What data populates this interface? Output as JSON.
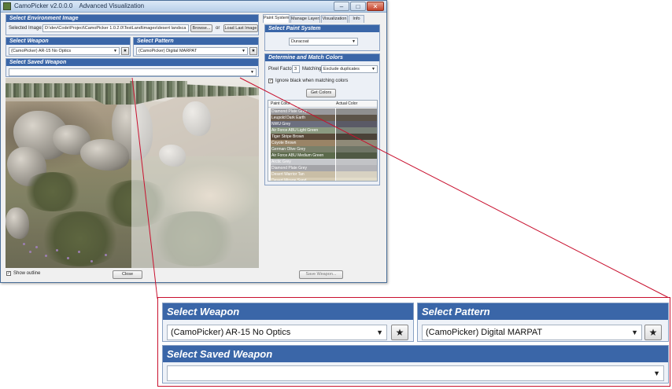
{
  "window": {
    "app_title": "CamoPicker",
    "version": "v2.0.0.0",
    "mode": "Advanced Visualization"
  },
  "environment": {
    "header": "Select Environment Image",
    "selected_label": "Selected Image:",
    "path_value": "D:\\dev\\Code\\Project\\CamoPicker 1.0.2.0\\TestLand\\images\\desert landsca",
    "browse_label": "Browse...",
    "or_label": "or",
    "load_last_label": "Load Last Image"
  },
  "weapon": {
    "header": "Select Weapon",
    "selected": "(CamoPicker) AR-15 No Optics",
    "star_label": "★"
  },
  "pattern": {
    "header": "Select Pattern",
    "selected": "(CamoPicker) Digital MARPAT",
    "star_label": "★"
  },
  "saved_weapon": {
    "header": "Select Saved Weapon",
    "selected": ""
  },
  "bottom": {
    "show_outline_label": "Show outline",
    "show_outline_checked": "✓",
    "close_label": "Close",
    "save_label": "Save Weapon..."
  },
  "tabs": [
    {
      "label": "Paint System"
    },
    {
      "label": "Manage Layers"
    },
    {
      "label": "Visualization"
    },
    {
      "label": "Info"
    }
  ],
  "paint_system": {
    "header": "Select Paint System",
    "selected": "Duracoat"
  },
  "colors": {
    "header": "Determine and Match Colors",
    "pixel_factor_label": "Pixel Factor",
    "pixel_factor_value": "3",
    "matching_label": "Matching",
    "matching_value": "Exclude duplicates",
    "ignore_label": "Ignore black when matching colors",
    "ignore_checked": "✓",
    "get_colors_label": "Get Colors",
    "col_paint": "Paint Color",
    "col_actual": "Actual Color",
    "rows": [
      {
        "name": "Diamond Plate Grey",
        "paint": "#9a9a9e",
        "actual": "#8f8f8f"
      },
      {
        "name": "Leupold Dark Earth",
        "paint": "#6e5f50",
        "actual": "#5b5348"
      },
      {
        "name": "NWU Grey",
        "paint": "#6c6f7f",
        "actual": "#5a5a66"
      },
      {
        "name": "Air Force ABU Light Green",
        "paint": "#8b9a80",
        "actual": "#7a8278"
      },
      {
        "name": "Tiger Stripe Brown",
        "paint": "#5a4a3a",
        "actual": "#4a4238"
      },
      {
        "name": "Coyote Brown",
        "paint": "#9a8466",
        "actual": "#8f8a78"
      },
      {
        "name": "German Olive Grey",
        "paint": "#7a806a",
        "actual": "#6f7566"
      },
      {
        "name": "Air Force ABU Medium Green",
        "paint": "#5b6a4b",
        "actual": "#4f5944"
      },
      {
        "name": "Arctic Grey",
        "paint": "#c6c8cc",
        "actual": "#c2c3c6"
      },
      {
        "name": "Diamond Plate Grey",
        "paint": "#a4a4a8",
        "actual": "#b4b4b8"
      },
      {
        "name": "Desert Warrior Tan",
        "paint": "#c9bea6",
        "actual": "#d8d2c2"
      },
      {
        "name": "Desert Mirage Sand",
        "paint": "#d6ccb4",
        "actual": "#e2dcca"
      }
    ]
  },
  "zoom": {
    "weapon_header": "Select Weapon",
    "weapon_selected": "(CamoPicker) AR-15 No Optics",
    "pattern_header": "Select Pattern",
    "pattern_selected": "(CamoPicker) Digital MARPAT",
    "saved_header": "Select Saved Weapon",
    "saved_selected": "",
    "star_label": "★",
    "dropdown_arrow": "▼"
  },
  "icons": {
    "dropdown": "chevron-down-icon",
    "star": "star-icon",
    "minimize": "minimize-icon",
    "maximize": "maximize-icon",
    "close": "close-icon"
  },
  "theme": {
    "header_blue": "#3a66a8",
    "callout_red": "#c8102e"
  }
}
